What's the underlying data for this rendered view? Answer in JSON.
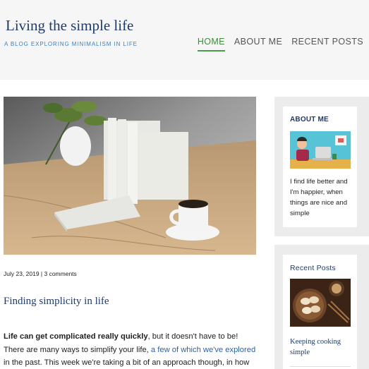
{
  "site": {
    "title": "Living the simple life",
    "tagline": "A BLOG EXPLORING MINIMALISM IN LIFE"
  },
  "nav": {
    "items": [
      {
        "label": "HOME",
        "active": true
      },
      {
        "label": "ABOUT ME",
        "active": false
      },
      {
        "label": "RECENT POSTS",
        "active": false
      }
    ]
  },
  "post": {
    "image_icon": "books-plant-coffee-photo",
    "meta": "July 23, 2019 | 3 comments",
    "title": "Finding simplicity in life",
    "excerpt_bold": "Life can get complicated really quickly",
    "excerpt_part1": ", but it doesn't have to be! There are many ways to simplify your life, ",
    "excerpt_link": "a few of which we've explored",
    "excerpt_part2": " in the past. This week we're taking a bit of an approach though, in how you can find simplicity in"
  },
  "sidebar": {
    "about": {
      "title": "ABOUT ME",
      "image_icon": "person-at-laptop-illustration",
      "text": "I find life better and I'm happier, when things are nice and simple"
    },
    "recent": {
      "title": "Recent Posts",
      "image_icon": "dumplings-photo",
      "post_link": "Keeping cooking simple"
    }
  },
  "colors": {
    "title_navy": "#1f3a6b",
    "tagline_blue": "#3a7fc1",
    "nav_active_green": "#4a9a4a",
    "link_blue": "#2b62a8",
    "header_bg": "#f6f6f6",
    "sidebar_bg": "#ececec"
  }
}
